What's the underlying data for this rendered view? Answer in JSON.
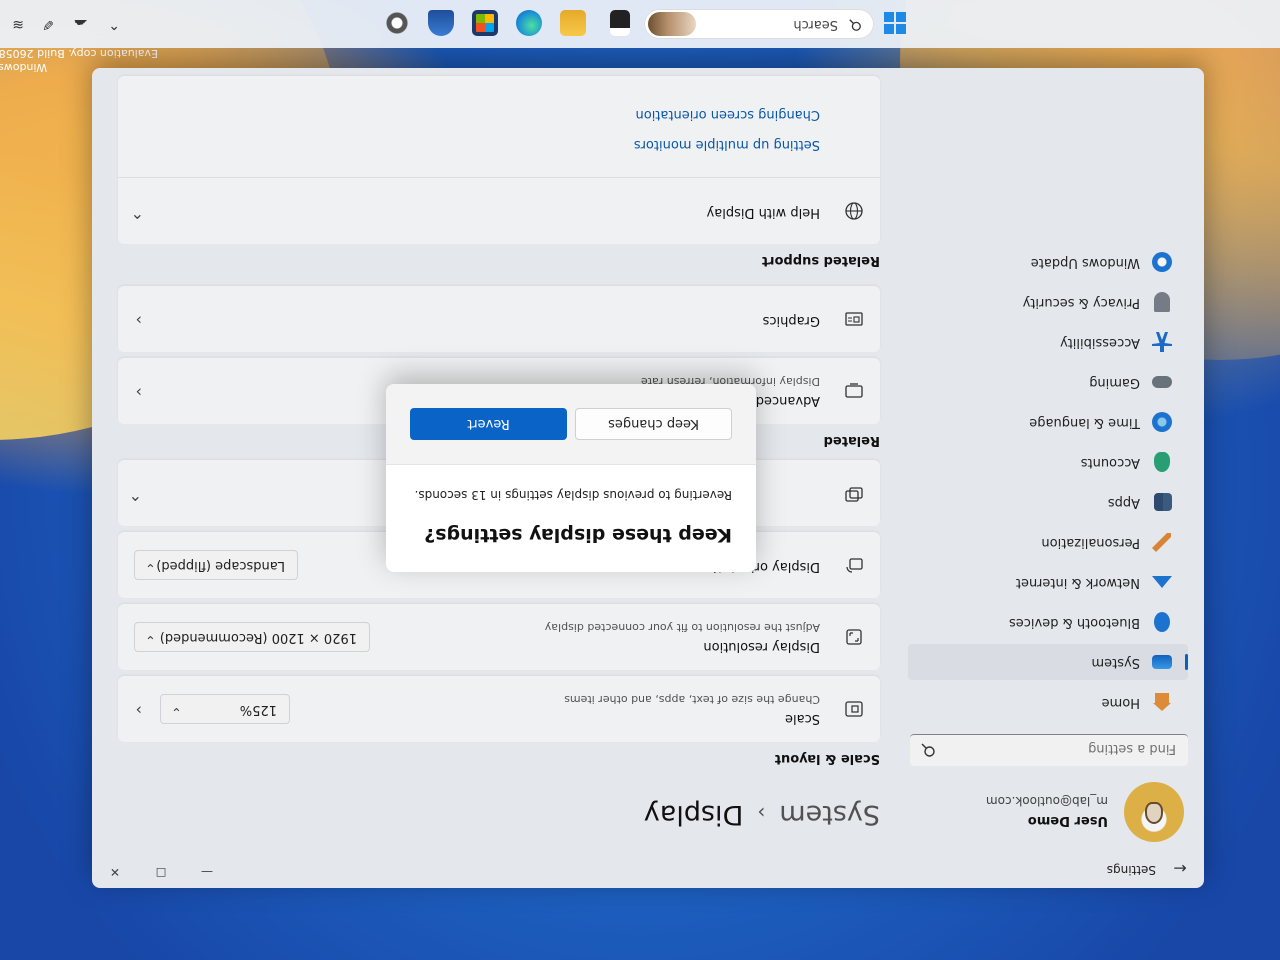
{
  "watermark": {
    "line1": "Windows",
    "line2": "Evaluation copy. Build 26058.c"
  },
  "window": {
    "title": "Settings",
    "back_icon": "arrow-left-icon"
  },
  "user": {
    "name": "User Demo",
    "email": "m_lab@outlook.com"
  },
  "search": {
    "placeholder": "Find a setting",
    "icon": "search-icon"
  },
  "nav": {
    "items": [
      {
        "label": "Home",
        "icon": "home-icon",
        "color": "#e8913a"
      },
      {
        "label": "System",
        "icon": "monitor-icon",
        "color": "#1e8ae6"
      },
      {
        "label": "Bluetooth & devices",
        "icon": "bluetooth-icon",
        "color": "#1e78d8"
      },
      {
        "label": "Network & internet",
        "icon": "wifi-icon",
        "color": "#1e78d8"
      },
      {
        "label": "Personalization",
        "icon": "brush-icon",
        "color": "#e08a3a"
      },
      {
        "label": "Apps",
        "icon": "apps-icon",
        "color": "#3c5f86"
      },
      {
        "label": "Accounts",
        "icon": "person-icon",
        "color": "#2aa57a"
      },
      {
        "label": "Time & language",
        "icon": "globe-clock-icon",
        "color": "#1e78d8"
      },
      {
        "label": "Gaming",
        "icon": "gamepad-icon",
        "color": "#6e7680"
      },
      {
        "label": "Accessibility",
        "icon": "accessibility-icon",
        "color": "#1e6fd0"
      },
      {
        "label": "Privacy & security",
        "icon": "shield-icon",
        "color": "#7a828c"
      },
      {
        "label": "Windows Update",
        "icon": "update-icon",
        "color": "#1e78d8"
      }
    ]
  },
  "breadcrumb": {
    "parent": "System",
    "separator": "›",
    "current": "Display"
  },
  "scale_layout": {
    "section_title": "Scale & layout",
    "scale": {
      "title": "Scale",
      "subtitle": "Change the size of text, apps, and other items",
      "value": "125%",
      "icon": "scale-icon"
    },
    "resolution": {
      "title": "Display resolution",
      "subtitle": "Adjust the resolution to fit your connected display",
      "value": "1920 × 1200 (Recommended)",
      "icon": "resolution-icon"
    },
    "orientation": {
      "title": "Display orientation",
      "value": "Landscape (flipped)",
      "icon": "orientation-icon"
    },
    "multiple_displays": {
      "icon": "multiple-displays-icon"
    }
  },
  "related": {
    "section_title": "Related",
    "advanced_display": {
      "title": "Advanced display",
      "subtitle": "Display information, refresh rate",
      "icon": "display-icon"
    },
    "graphics": {
      "title": "Graphics",
      "icon": "graphics-icon"
    }
  },
  "related_support": {
    "section_title": "Related support",
    "help": {
      "title": "Help with Display",
      "icon": "globe-icon"
    },
    "links": [
      "Setting up multiple monitors",
      "Changing screen orientation"
    ]
  },
  "dialog": {
    "title": "Keep these display settings?",
    "message": "Reverting to previous display settings in 13 seconds.",
    "keep_label": "Keep changes",
    "revert_label": "Revert",
    "accent": "#0a64c7"
  },
  "taskbar": {
    "search_label": "Search",
    "apps": [
      "file-explorer-icon",
      "edge-icon",
      "store-icon",
      "folder-icon",
      "task-view-icon",
      "copilot-icon",
      "settings-icon"
    ]
  }
}
